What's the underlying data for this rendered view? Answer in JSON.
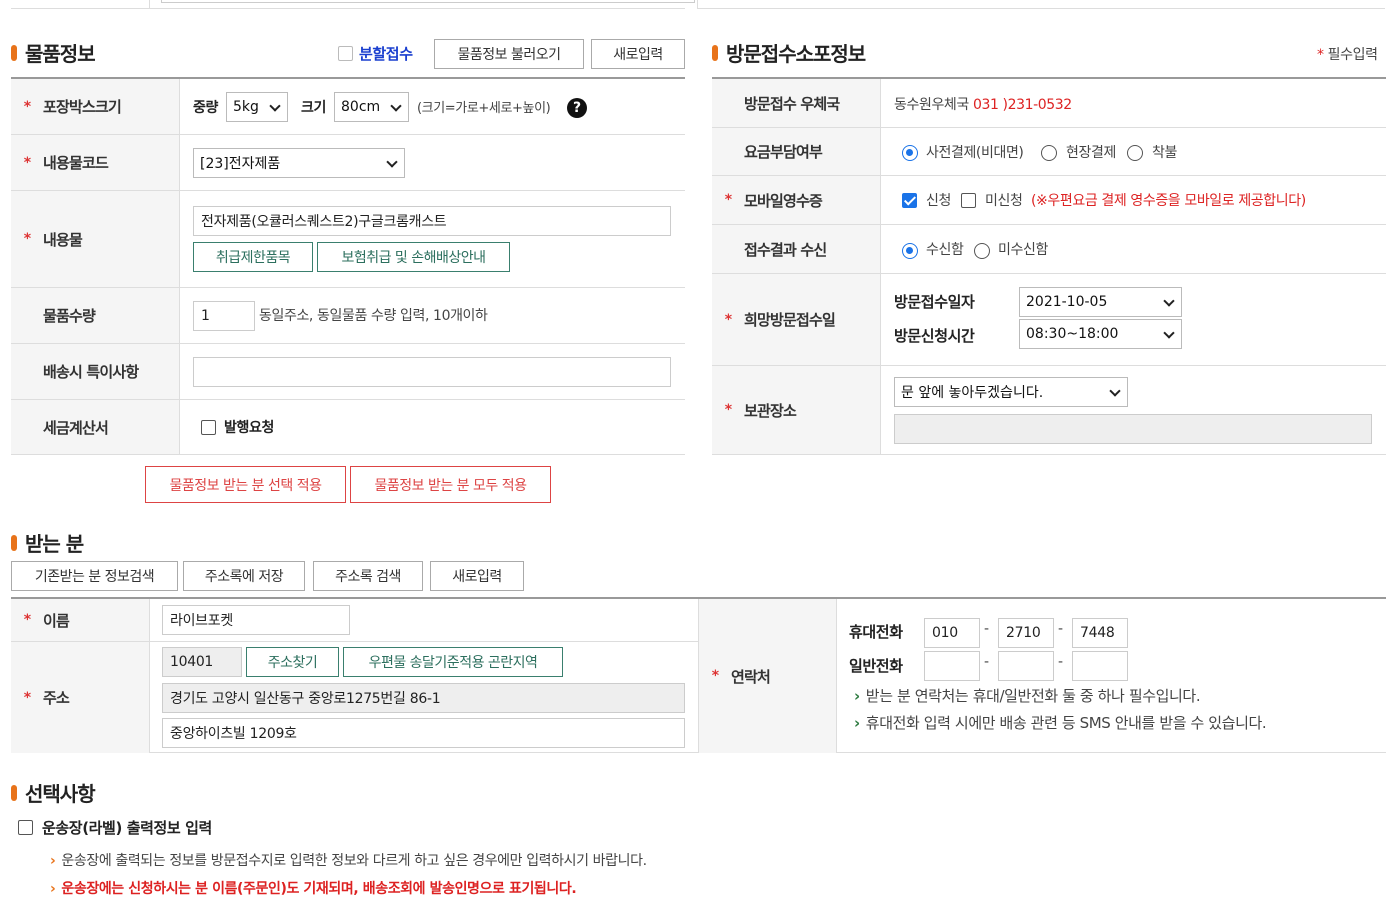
{
  "item_section": {
    "title": "물품정보",
    "split_checkbox_label": "분할접수",
    "load_button": "물품정보 불러오기",
    "new_button": "새로입력",
    "box_size": {
      "label": "포장박스크기",
      "weight_label": "중량",
      "weight_value": "5kg",
      "size_label": "크기",
      "size_value": "80cm",
      "size_hint": "(크기=가로+세로+높이)",
      "help_icon_text": "?"
    },
    "content_code": {
      "label": "내용물코드",
      "value": "[23]전자제품"
    },
    "content": {
      "label": "내용물",
      "value": "전자제품(오큘러스퀘스트2)구글크롬캐스트",
      "restricted_button": "취급제한품목",
      "insurance_button": "보험취급 및 손해배상안내"
    },
    "quantity": {
      "label": "물품수량",
      "value": "1",
      "hint": "동일주소, 동일물품 수량 입력, 10개이하"
    },
    "delivery_note": {
      "label": "배송시 특이사항",
      "value": ""
    },
    "tax_invoice": {
      "label": "세금계산서",
      "checkbox_label": "발행요청"
    },
    "apply_selected_button": "물품정보 받는 분 선택 적용",
    "apply_all_button": "물품정보 받는 분 모두 적용"
  },
  "visit_section": {
    "title": "방문접수소포정보",
    "required_note": "필수입력",
    "required_star": "*",
    "post_office": {
      "label": "방문접수 우체국",
      "name": "동수원우체국",
      "phone": "031 )231-0532"
    },
    "payment": {
      "label": "요금부담여부",
      "options": [
        "사전결제(비대면)",
        "현장결제",
        "착불"
      ],
      "selected": "사전결제(비대면)"
    },
    "mobile_receipt": {
      "label": "모바일영수증",
      "apply": "신청",
      "not_apply": "미신청",
      "note": "(※우편요금 결제 영수증을 모바일로 제공합니다)"
    },
    "result_receive": {
      "label": "접수결과 수신",
      "options": [
        "수신함",
        "미수신함"
      ],
      "selected": "수신함"
    },
    "desired_date": {
      "label": "희망방문접수일",
      "date_label": "방문접수일자",
      "date_value": "2021-10-05",
      "time_label": "방문신청시간",
      "time_value": "08:30~18:00"
    },
    "storage": {
      "label": "보관장소",
      "value": "문 앞에 놓아두겠습니다.",
      "extra": ""
    }
  },
  "recipient_section": {
    "title": "받는 분",
    "buttons": [
      "기존받는 분 정보검색",
      "주소록에 저장",
      "주소록 검색",
      "새로입력"
    ],
    "name": {
      "label": "이름",
      "value": "라이브포켓"
    },
    "address": {
      "label": "주소",
      "zipcode": "10401",
      "find_button": "주소찾기",
      "difficult_button": "우편물 송달기준적용 곤란지역",
      "line1": "경기도 고양시 일산동구 중앙로1275번길 86-1",
      "line2": "중앙하이츠빌 1209호"
    },
    "contact": {
      "label": "연락처",
      "mobile_label": "휴대전화",
      "mobile": [
        "010",
        "2710",
        "7448"
      ],
      "phone_label": "일반전화",
      "phone": [
        "",
        "",
        ""
      ],
      "dash": "-",
      "note1": "받는 분 연락처는 휴대/일반전화 둘 중 하나 필수입니다.",
      "note2": "휴대전화 입력 시에만 배송 관련 등 SMS 안내를 받을 수 있습니다."
    }
  },
  "options_section": {
    "title": "선택사항",
    "label_print_checkbox": "운송장(라벨) 출력정보 입력",
    "note1": "운송장에 출력되는 정보를 방문접수지로 입력한 정보와 다르게 하고 싶은 경우에만 입력하시기 바랍니다.",
    "note2": "운송장에는 신청하시는 분 이름(주문인)도 기재되며, 배송조회에 발송인명으로 표기됩니다."
  },
  "star": "*",
  "caret": "›"
}
